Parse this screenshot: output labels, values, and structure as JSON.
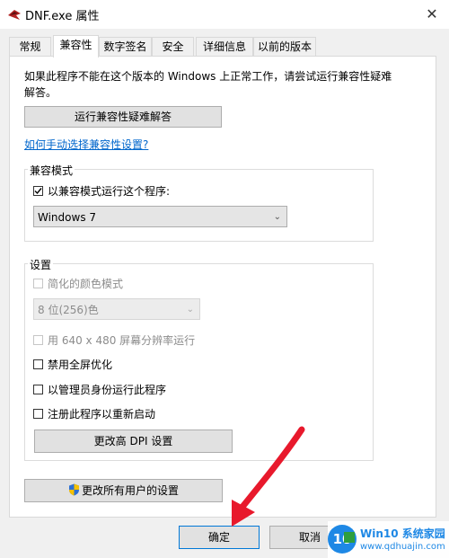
{
  "window": {
    "title": "DNF.exe 属性",
    "close_glyph": "✕"
  },
  "tabs": [
    "常规",
    "兼容性",
    "数字签名",
    "安全",
    "详细信息",
    "以前的版本"
  ],
  "compat": {
    "description": "如果此程序不能在这个版本的 Windows 上正常工作，请尝试运行兼容性疑难解答。",
    "troubleshoot_button": "运行兼容性疑难解答",
    "manual_link": "如何手动选择兼容性设置?",
    "mode_group": {
      "title": "兼容模式",
      "checkbox_label": "以兼容模式运行这个程序:",
      "checked": true,
      "selected_os": "Windows 7"
    },
    "settings_group": {
      "title": "设置",
      "reduced_color_label": "简化的颜色模式",
      "color_select": "8 位(256)色",
      "res_640_label": "用 640 x 480 屏幕分辨率运行",
      "disable_fullscreen_label": "禁用全屏优化",
      "run_as_admin_label": "以管理员身份运行此程序",
      "register_restart_label": "注册此程序以重新启动",
      "dpi_button": "更改高 DPI 设置"
    },
    "all_users_button": "更改所有用户的设置"
  },
  "footer": {
    "ok_button": "确定",
    "cancel_button": "取消"
  },
  "watermark": {
    "logo_text": "10",
    "brand": "Win10 系统家园",
    "url": "www.qdhuajin.com"
  },
  "colors": {
    "accent_arrow": "#e8192c",
    "link": "#0066cc",
    "shield_blue": "#2b6fd6",
    "shield_yellow": "#f5c000"
  }
}
